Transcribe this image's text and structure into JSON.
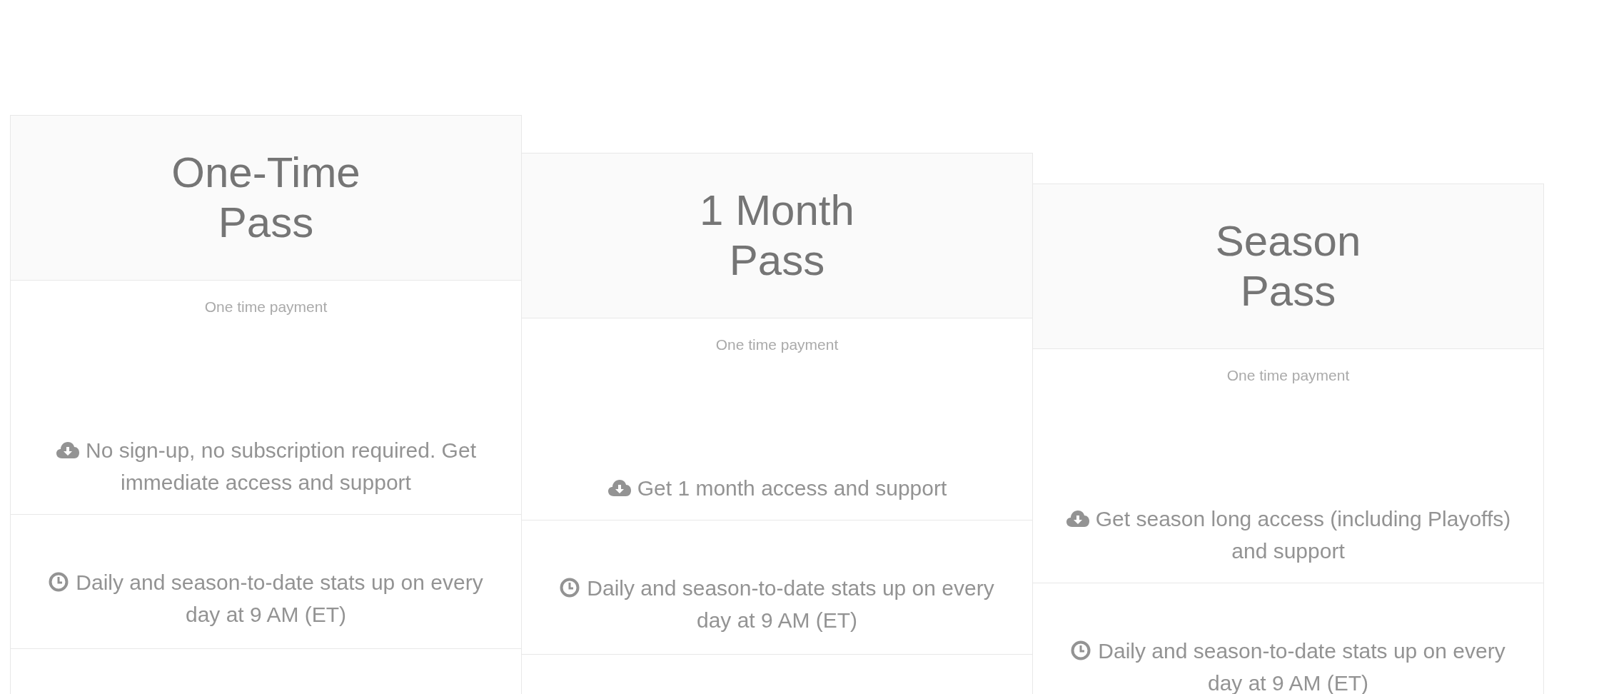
{
  "plans": [
    {
      "title": "One-Time Pass",
      "payment": "One time payment",
      "features": [
        {
          "kind": "download",
          "text": "No sign-up, no subscription required. Get immediate access and support"
        },
        {
          "kind": "clock",
          "text": "Daily and season-to-date stats up on every day at 9 AM (ET)"
        }
      ]
    },
    {
      "title": "1 Month Pass",
      "payment": "One time payment",
      "features": [
        {
          "kind": "download",
          "text": "Get 1 month access and support"
        },
        {
          "kind": "clock",
          "text": "Daily and season-to-date stats up on every day at 9 AM (ET)"
        }
      ]
    },
    {
      "title": "Season Pass",
      "payment": "One time payment",
      "features": [
        {
          "kind": "download",
          "text": "Get season long access (including Playoffs) and support"
        },
        {
          "kind": "clock",
          "text": "Daily and season-to-date stats up on every day at 9 AM (ET)"
        }
      ]
    }
  ]
}
